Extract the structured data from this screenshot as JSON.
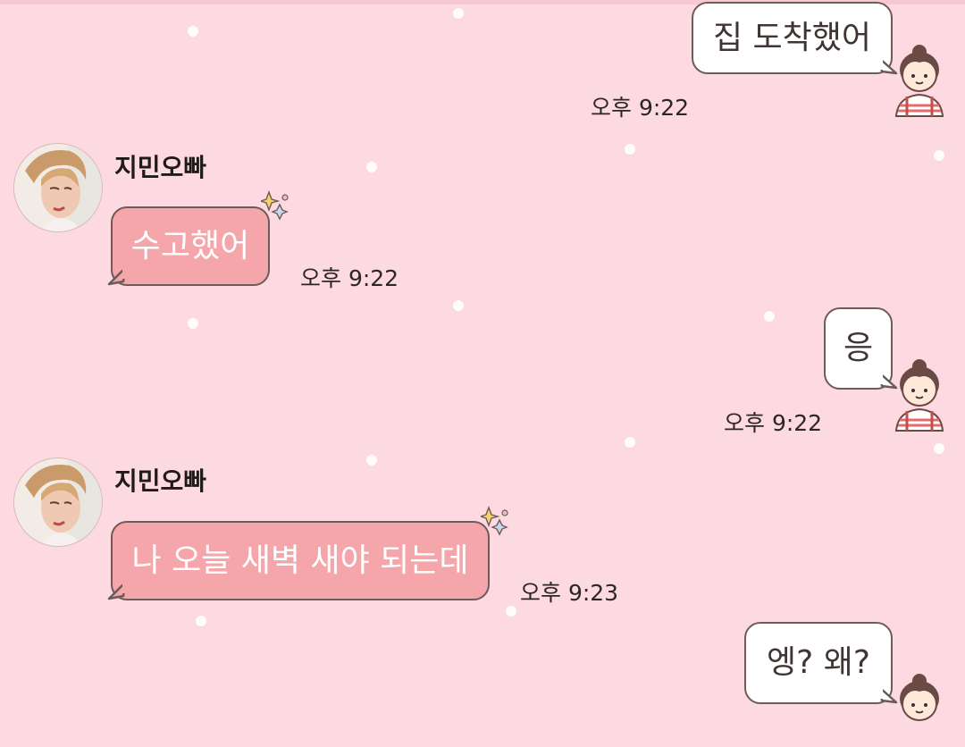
{
  "chat": {
    "messages": [
      {
        "sender": "me",
        "text": "집 도착했어",
        "time": "오후 9:22"
      },
      {
        "sender": "지민오빠",
        "text": "수고했어",
        "time": "오후 9:22"
      },
      {
        "sender": "me",
        "text": "응",
        "time": "오후 9:22"
      },
      {
        "sender": "지민오빠",
        "text": "나 오늘 새벽 새야 되는데",
        "time": "오후 9:23"
      },
      {
        "sender": "me",
        "text": "엥? 왜?",
        "time": ""
      }
    ]
  },
  "contact": {
    "name": "지민오빠",
    "avatar_icon": "profile-photo"
  },
  "me": {
    "avatar_icon": "girl-sticker-avatar"
  },
  "colors": {
    "background": "#fdd9e1",
    "my_bubble": "#ffffff",
    "their_bubble": "#f5a6ab",
    "bubble_border": "#6e5a58"
  }
}
